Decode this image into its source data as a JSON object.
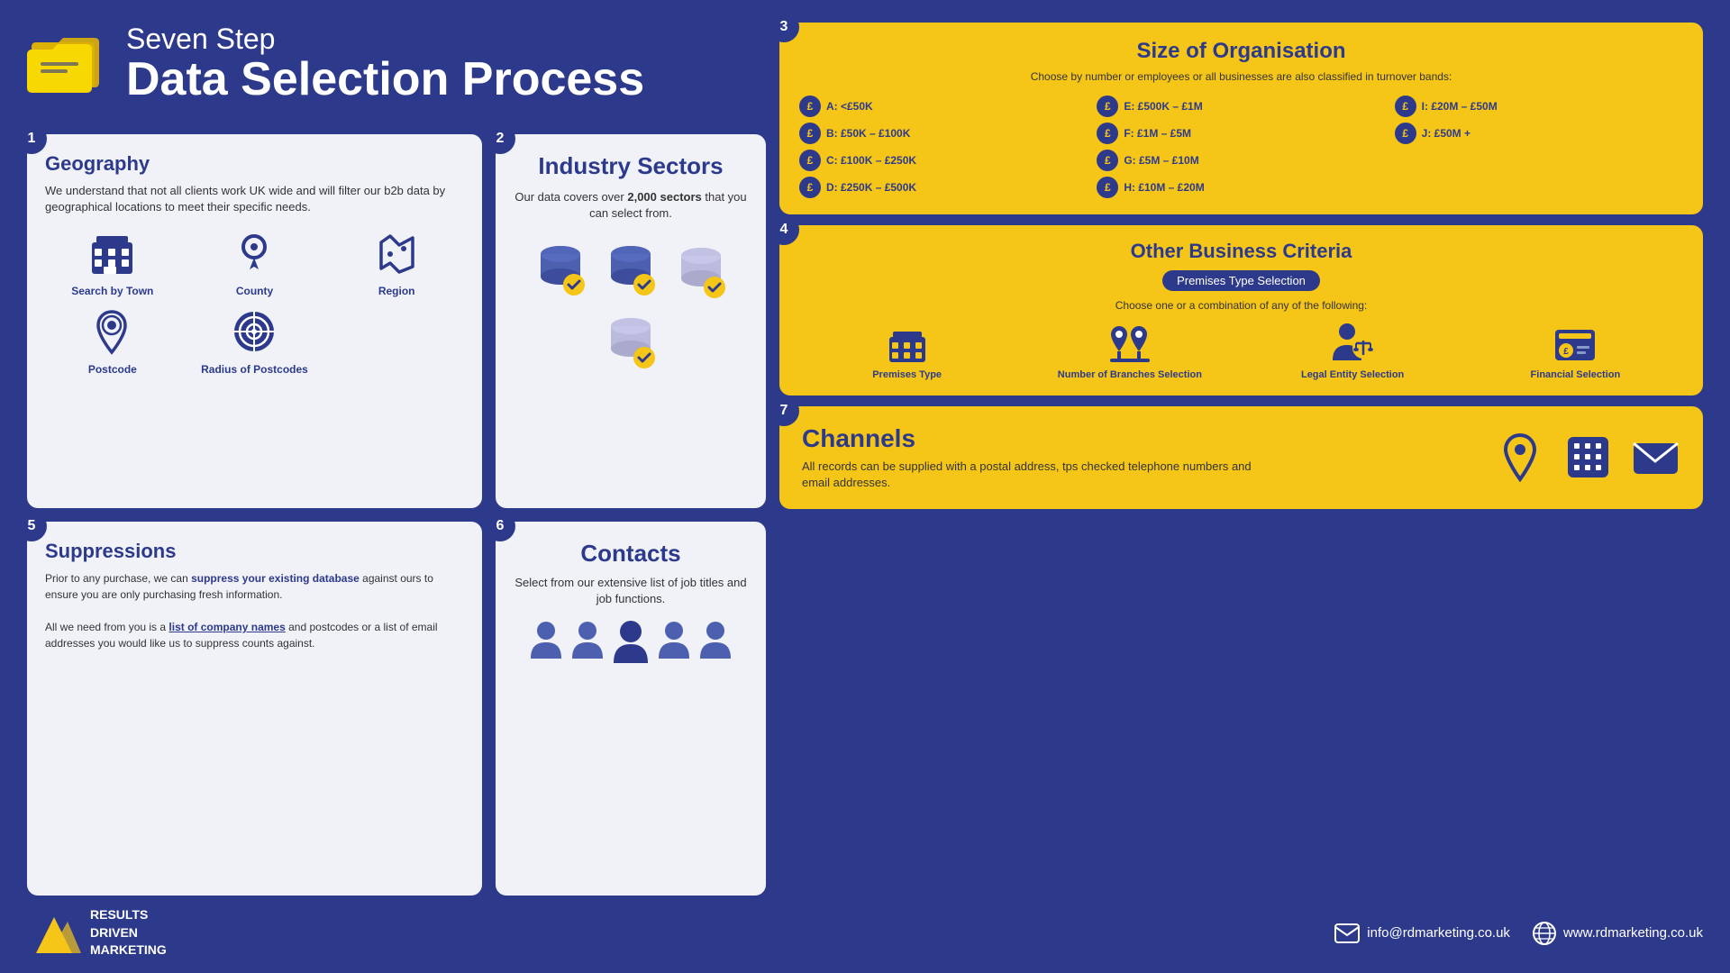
{
  "header": {
    "subtitle": "Seven Step",
    "title": "Data Selection Process"
  },
  "steps": {
    "step1": {
      "number": "1",
      "title": "Geography",
      "description": "We understand that not all clients work UK wide and will filter our b2b data by geographical locations to meet their specific needs.",
      "icons": [
        {
          "name": "Search by Town",
          "icon": "building"
        },
        {
          "name": "County",
          "icon": "location"
        },
        {
          "name": "Region",
          "icon": "region"
        },
        {
          "name": "Postcode",
          "icon": "postcode"
        },
        {
          "name": "Radius of Postcodes",
          "icon": "radius"
        }
      ]
    },
    "step2": {
      "number": "2",
      "title": "Industry Sectors",
      "description": "Our data covers over 2,000 sectors that you can select from.",
      "highlight": "2,000"
    },
    "step3": {
      "number": "3",
      "title": "Size of Organisation",
      "subtitle": "Choose by number or employees or all businesses are also classified in turnover bands:",
      "bands": [
        {
          "label": "A: <£50K"
        },
        {
          "label": "E: £500K – £1M"
        },
        {
          "label": "I: £20M – £50M"
        },
        {
          "label": "B: £50K – £100K"
        },
        {
          "label": "F: £1M – £5M"
        },
        {
          "label": "J: £50M +"
        },
        {
          "label": "C: £100K – £250K"
        },
        {
          "label": "G: £5M – £10M"
        },
        {
          "label": ""
        },
        {
          "label": "D: £250K – £500K"
        },
        {
          "label": "H: £10M – £20M"
        },
        {
          "label": ""
        }
      ]
    },
    "step4": {
      "number": "4",
      "title": "Other Business Criteria",
      "badge": "Premises Type Selection",
      "description": "Choose one or a combination of any of the following:",
      "criteria": [
        {
          "name": "Premises Type"
        },
        {
          "name": "Number of Branches Selection"
        },
        {
          "name": "Legal Entity Selection"
        },
        {
          "name": "Financial Selection"
        }
      ]
    },
    "step5": {
      "number": "5",
      "title": "Suppressions",
      "para1": "Prior to any purchase, we can suppress your existing database against ours to ensure you are only purchasing fresh information.",
      "para1_highlight": "suppress your existing database",
      "para2_before": "All we need from you is a ",
      "para2_link": "list of company names",
      "para2_after": " and postcodes or a list of email addresses you would like us to suppress counts against."
    },
    "step6": {
      "number": "6",
      "title": "Contacts",
      "description": "Select from our extensive list of job titles and job functions."
    },
    "step7": {
      "number": "7",
      "title": "Channels",
      "description": "All records can be supplied with a postal address, tps checked telephone numbers and email addresses."
    }
  },
  "footer": {
    "logo_lines": [
      "RESULTS",
      "DRIVEN",
      "MARKETING"
    ],
    "email": "info@rdmarketing.co.uk",
    "website": "www.rdmarketing.co.uk"
  }
}
